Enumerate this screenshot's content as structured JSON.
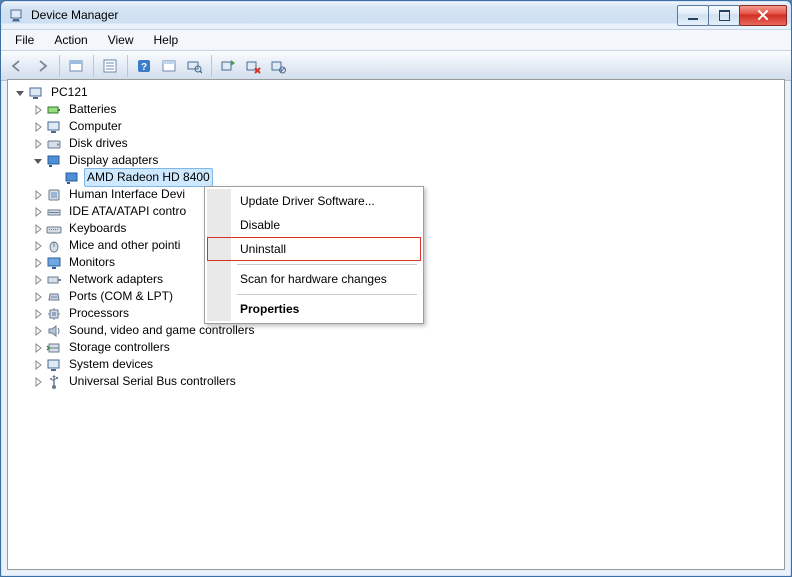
{
  "window": {
    "title": "Device Manager"
  },
  "menu": {
    "file": "File",
    "action": "Action",
    "view": "View",
    "help": "Help"
  },
  "tree": {
    "root": "PC121",
    "items": {
      "batteries": "Batteries",
      "computer": "Computer",
      "disk_drives": "Disk drives",
      "display_adapters": "Display adapters",
      "display_child": "AMD Radeon HD 8400",
      "hid": "Human Interface Devi",
      "ide": "IDE ATA/ATAPI contro",
      "keyboards": "Keyboards",
      "mice": "Mice and other pointi",
      "monitors": "Monitors",
      "network": "Network adapters",
      "ports": "Ports (COM & LPT)",
      "processors": "Processors",
      "sound": "Sound, video and game controllers",
      "storage": "Storage controllers",
      "system": "System devices",
      "usb": "Universal Serial Bus controllers"
    }
  },
  "context_menu": {
    "update": "Update Driver Software...",
    "disable": "Disable",
    "uninstall": "Uninstall",
    "scan": "Scan for hardware changes",
    "properties": "Properties"
  }
}
